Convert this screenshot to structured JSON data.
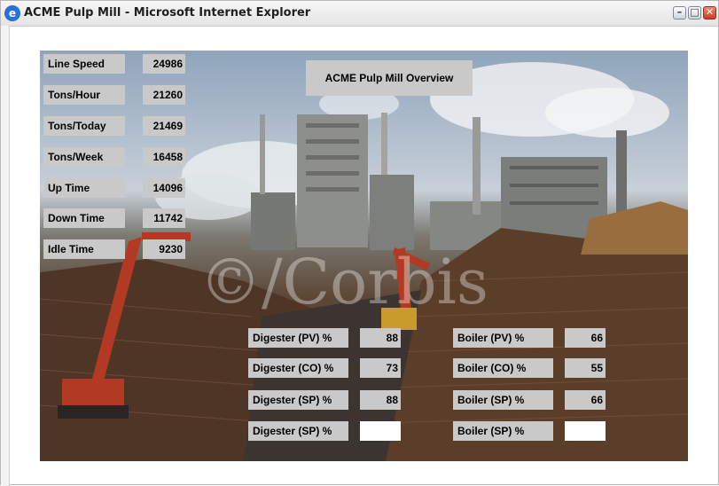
{
  "window": {
    "title": "ACME Pulp Mill - Microsoft Internet Explorer",
    "minimize": "–",
    "maximize": "□",
    "close": "✕"
  },
  "overview": {
    "title": "ACME Pulp Mill Overview"
  },
  "stats": [
    {
      "label": "Line Speed",
      "value": "24986"
    },
    {
      "label": "Tons/Hour",
      "value": "21260"
    },
    {
      "label": "Tons/Today",
      "value": "21469"
    },
    {
      "label": "Tons/Week",
      "value": "16458"
    },
    {
      "label": "Up Time",
      "value": "14096"
    },
    {
      "label": "Down Time",
      "value": "11742"
    },
    {
      "label": "Idle Time",
      "value": "9230"
    }
  ],
  "digester": [
    {
      "label": "Digester (PV) %",
      "value": "88"
    },
    {
      "label": "Digester (CO) %",
      "value": "73"
    },
    {
      "label": "Digester (SP) %",
      "value": "88"
    },
    {
      "label": "Digester (SP) %",
      "value": ""
    }
  ],
  "boiler": [
    {
      "label": "Boiler (PV) %",
      "value": "66"
    },
    {
      "label": "Boiler (CO) %",
      "value": "55"
    },
    {
      "label": "Boiler (SP) %",
      "value": "66"
    },
    {
      "label": "Boiler (SP) %",
      "value": ""
    }
  ],
  "watermark": "©/Corbis"
}
